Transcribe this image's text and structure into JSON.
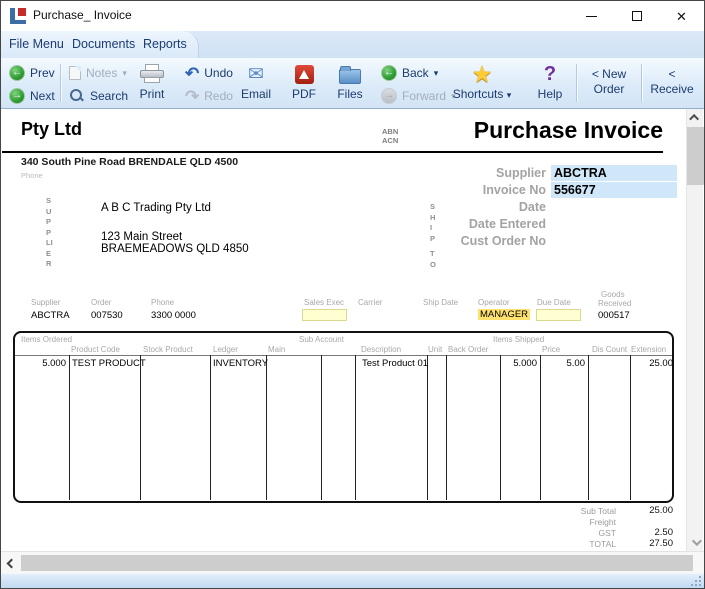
{
  "window": {
    "title": "Purchase_ Invoice"
  },
  "icons": {
    "left_arrow": "←",
    "right_arrow": "→",
    "undo": "↶",
    "redo": "↷",
    "caret": "▾",
    "star": "★",
    "help": "?",
    "email": "✉",
    "close": "✕"
  },
  "menu": {
    "items": [
      {
        "label": "File Menu"
      },
      {
        "label": "Documents"
      },
      {
        "label": "Reports"
      }
    ]
  },
  "toolbar": {
    "prev": "Prev",
    "next": "Next",
    "notes": "Notes",
    "search": "Search",
    "print": "Print",
    "undo": "Undo",
    "redo": "Redo",
    "email": "Email",
    "pdf": "PDF",
    "files": "Files",
    "back": "Back",
    "forward": "Forward",
    "shortcuts": "Shortcuts",
    "help": "Help",
    "new_order_line1": "< New",
    "new_order_line2": "Order",
    "receive_line1": "<",
    "receive_line2": "Receive"
  },
  "invoice": {
    "company": "Pty Ltd",
    "abn_label": "ABN",
    "acn_label": "ACN",
    "doc_title": "Purchase Invoice",
    "address_line": "340 South Pine Road BRENDALE QLD 4500",
    "phone_label": "Phone",
    "supplier_vertical": "SUPPLIER",
    "ship_vertical": "SHIP",
    "to_vertical": "TO",
    "supplier_block": {
      "name": "A B C Trading Pty Ltd",
      "street": "123 Main Street",
      "city": "BRAEMEADOWS QLD 4850"
    },
    "fields": {
      "supplier_label": "Supplier",
      "supplier_value": "ABCTRA",
      "invoice_no_label": "Invoice No",
      "invoice_no_value": "556677",
      "date_label": "Date",
      "date_entered_label": "Date Entered",
      "cust_order_no_label": "Cust Order No"
    },
    "info_row": {
      "supplier_label": "Supplier",
      "supplier": "ABCTRA",
      "order_label": "Order",
      "order": "007530",
      "phone_label": "Phone",
      "phone": "3300 0000",
      "sales_exec_label": "Sales Exec",
      "sales_exec": "",
      "carrier_label": "Carrier",
      "ship_date_label": "Ship Date",
      "operator_label": "Operator",
      "operator": "MANAGER",
      "due_date_label": "Due Date",
      "due_date": "",
      "goods_received_label_1": "Goods",
      "goods_received_label_2": "Received",
      "goods_received": "000517"
    },
    "table": {
      "group_headers": [
        "Items Ordered",
        "Sub Account",
        "Items Shipped"
      ],
      "columns": [
        "Product Code",
        "Stock Product",
        "Ledger",
        "Main",
        "Description",
        "Unit",
        "Back Order",
        "Price",
        "Dis Count",
        "Extension"
      ],
      "row": {
        "qty_ordered": "5.000",
        "product_code": "TEST PRODUCT",
        "stock_product": "",
        "ledger": "INVENTORY",
        "main": "",
        "sub_account2": "",
        "description": "Test Product 01",
        "unit": "",
        "back_order": "",
        "qty_shipped": "5.000",
        "price": "5.00",
        "discount": "",
        "extension": "25.00"
      }
    },
    "totals": {
      "sub_total_label": "Sub Total",
      "sub_total": "25.00",
      "freight_label": "Freight",
      "freight": "",
      "gst_label": "GST",
      "gst": "2.50",
      "total_label": "TOTAL",
      "total": "27.50"
    }
  },
  "colors": {
    "field_highlight_blue": "#cfe7f9",
    "field_highlight_yellow": "#ffe26e",
    "field_entry_yellow": "#ffffd2",
    "menu_text_navy": "#1a3c73",
    "toolbar_gradient_top": "#f4fafe",
    "toolbar_gradient_bottom": "#d2e4f5"
  }
}
